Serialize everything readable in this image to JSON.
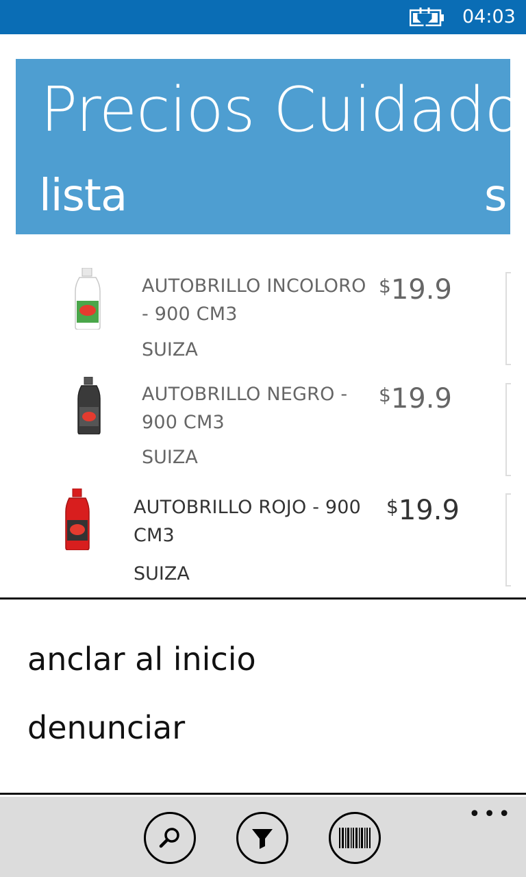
{
  "status": {
    "time": "04:03",
    "battery_icon": "battery-charging-icon"
  },
  "header": {
    "title": "Precios Cuidados",
    "pivot_active": "lista",
    "pivot_next": "su"
  },
  "products": [
    {
      "name": "AUTOBRILLO INCOLORO - 900 CM3",
      "brand": "SUIZA",
      "currency": "$",
      "price": "19.9",
      "bottle_color": "#ffffff"
    },
    {
      "name": "AUTOBRILLO NEGRO - 900 CM3",
      "brand": "SUIZA",
      "currency": "$",
      "price": "19.9",
      "bottle_color": "#3a3a3a"
    },
    {
      "name": "AUTOBRILLO ROJO - 900 CM3",
      "brand": "SUIZA",
      "currency": "$",
      "price": "19.9",
      "bottle_color": "#d81e1e"
    }
  ],
  "menu": {
    "items": [
      "anclar al inicio",
      "denunciar"
    ]
  },
  "app_bar": {
    "buttons": [
      {
        "icon": "search-icon"
      },
      {
        "icon": "filter-icon"
      },
      {
        "icon": "barcode-icon"
      }
    ],
    "more_label": "•••"
  },
  "colors": {
    "accent": "#4e9ed1",
    "status_bar": "#0a6db5",
    "app_bar": "#dcdcdc"
  }
}
